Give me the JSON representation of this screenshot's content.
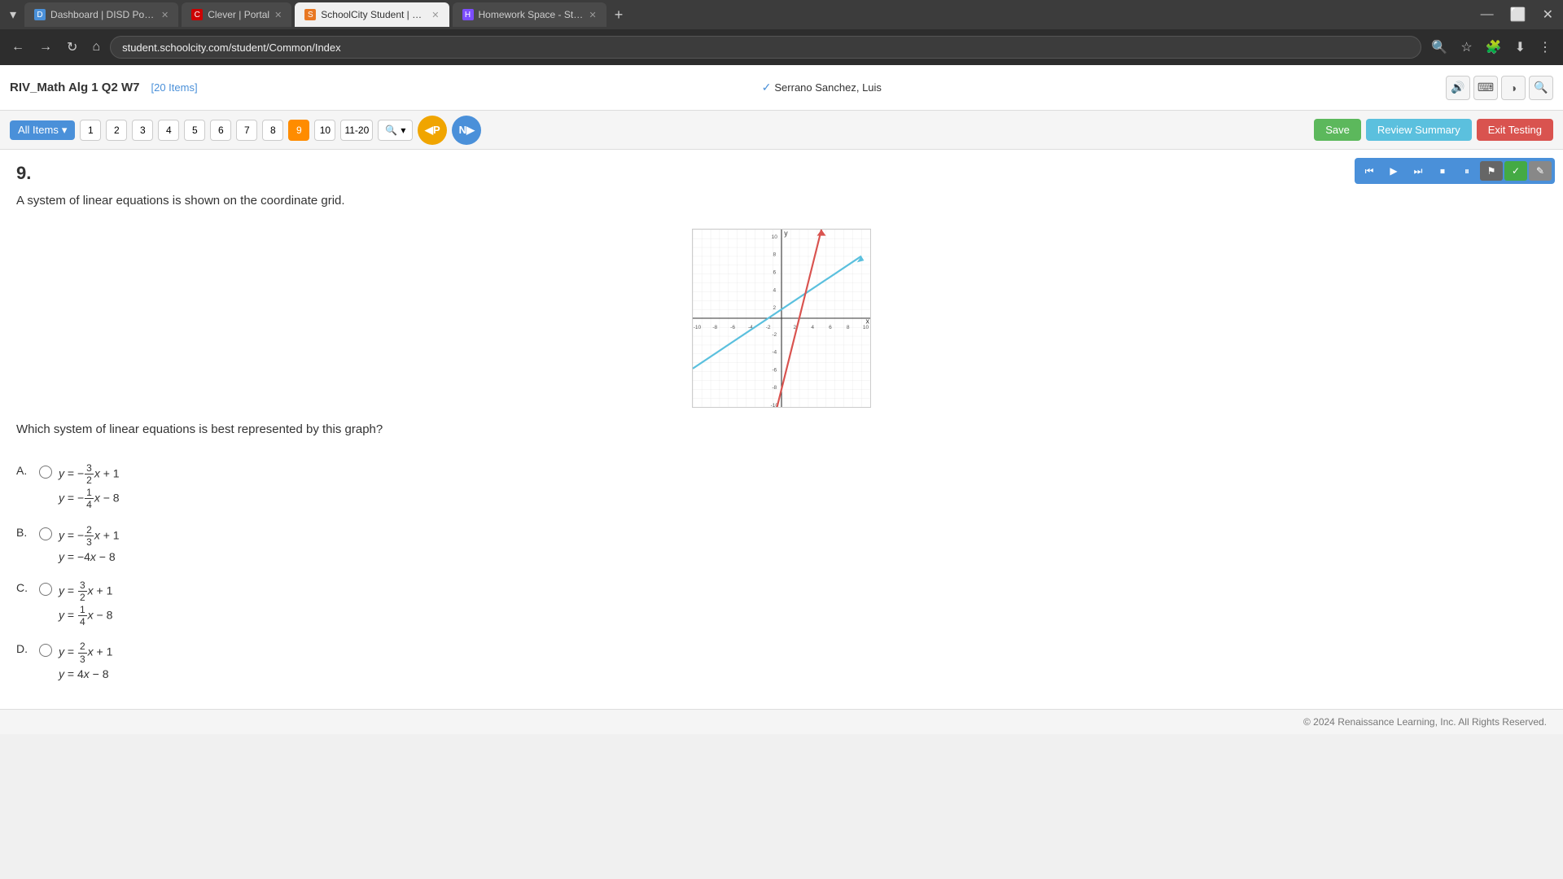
{
  "browser": {
    "tabs": [
      {
        "id": "tab1",
        "label": "Dashboard | DISD Portal",
        "favicon_color": "#4a90d9",
        "active": false
      },
      {
        "id": "tab2",
        "label": "Clever | Portal",
        "favicon_color": "#c00",
        "active": false
      },
      {
        "id": "tab3",
        "label": "SchoolCity Student | Renaissa...",
        "favicon_color": "#e87722",
        "active": true
      },
      {
        "id": "tab4",
        "label": "Homework Space - StudyX",
        "favicon_color": "#7c4dff",
        "active": false
      }
    ],
    "address": "student.schoolcity.com/student/Common/Index",
    "new_tab_icon": "+",
    "back_label": "←",
    "forward_label": "→",
    "refresh_label": "↻",
    "home_label": "⌂"
  },
  "app": {
    "title": "RIV_Math Alg 1 Q2 W7",
    "item_count": "[20 Items]",
    "user": {
      "name": "Serrano Sanchez, Luis",
      "verified_icon": "✓"
    },
    "accessibility_buttons": [
      "🔊",
      "⌨",
      "☀",
      "🔍"
    ],
    "nav": {
      "all_items_label": "All Items",
      "item_numbers": [
        "1",
        "2",
        "3",
        "4",
        "5",
        "6",
        "7",
        "8",
        "9",
        "10"
      ],
      "range_label": "11-20",
      "search_icon": "🔍",
      "prev_label": "P",
      "next_label": "N",
      "active_item": "9"
    },
    "toolbar": {
      "save_label": "Save",
      "review_summary_label": "Review Summary",
      "exit_testing_label": "Exit Testing"
    },
    "media_controls": [
      "⏮",
      "▶",
      "⏭",
      "⏹",
      "⏸"
    ],
    "media_flag": "⚑",
    "media_check": "✓",
    "media_edit": "✎"
  },
  "question": {
    "number": "9.",
    "text": "A system of linear equations is shown on the coordinate grid.",
    "bottom_question": "Which system of linear equations is best represented by this graph?",
    "choices": [
      {
        "letter": "A.",
        "line1": "y = −(3/2)x + 1",
        "line2": "y = −(1/4)x − 8"
      },
      {
        "letter": "B.",
        "line1": "y = −(2/3)x + 1",
        "line2": "y = −4x − 8"
      },
      {
        "letter": "C.",
        "line1": "y = (3/2)x + 1",
        "line2": "y = (1/4)x − 8"
      },
      {
        "letter": "D.",
        "line1": "y = (2/3)x + 1",
        "line2": "y = 4x − 8"
      }
    ]
  },
  "footer": {
    "copyright": "© 2024 Renaissance Learning, Inc. All Rights Reserved."
  }
}
